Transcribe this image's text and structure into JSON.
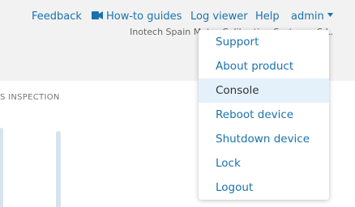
{
  "nav": {
    "feedback": "Feedback",
    "how_to_guides": "How-to guides",
    "log_viewer": "Log viewer",
    "help": "Help",
    "user": "admin"
  },
  "org_name": "Inotech Spain Motor Calibration Systems, S.L.",
  "panel": {
    "title": "S INSPECTION"
  },
  "dropdown": {
    "items": [
      {
        "label": "Support"
      },
      {
        "label": "About product"
      },
      {
        "label": "Console",
        "highlighted": true
      },
      {
        "label": "Reboot device"
      },
      {
        "label": "Shutdown device"
      },
      {
        "label": "Lock"
      },
      {
        "label": "Logout"
      }
    ]
  },
  "colors": {
    "link": "#1a73ad",
    "highlight_bg": "#e4f1fb",
    "page_bg": "#f2f2f2"
  },
  "icons": {
    "guides": "video-camera-icon",
    "user_menu": "caret-down-icon"
  }
}
